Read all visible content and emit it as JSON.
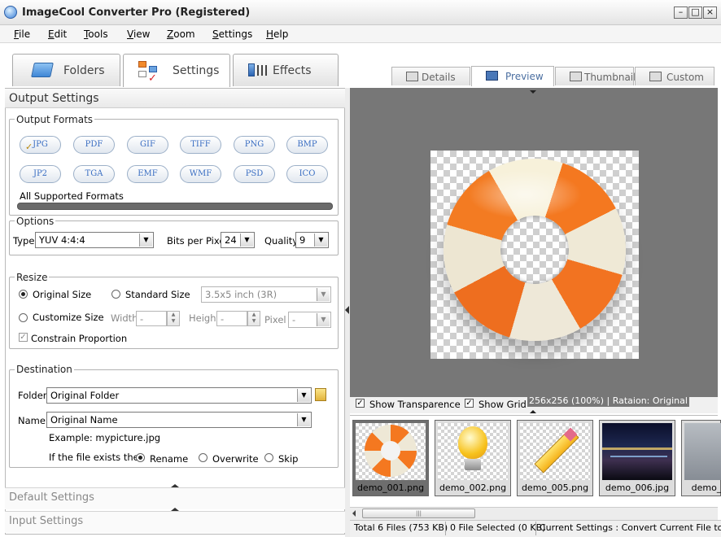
{
  "window": {
    "title": "ImageCool Converter Pro  (Registered)",
    "minimize": "–",
    "maximize": "□",
    "close": "×"
  },
  "menu": [
    "File",
    "Edit",
    "Tools",
    "View",
    "Zoom",
    "Settings",
    "Help"
  ],
  "main_tabs": [
    {
      "label": "Folders",
      "icon": "folder-icon",
      "active": false
    },
    {
      "label": "Settings",
      "icon": "settings-icon",
      "active": true
    },
    {
      "label": "Effects",
      "icon": "effects-icon",
      "active": false
    }
  ],
  "view_tabs": [
    {
      "label": "Details",
      "active": false
    },
    {
      "label": "Preview",
      "active": true
    },
    {
      "label": "Thumbnails",
      "active": false
    },
    {
      "label": "Custom",
      "active": false
    }
  ],
  "output_settings": {
    "title": "Output Settings",
    "formats_title": "Output Formats",
    "formats": [
      "JPG",
      "PDF",
      "GIF",
      "TIFF",
      "PNG",
      "BMP",
      "JP2",
      "TGA",
      "EMF",
      "WMF",
      "PSD",
      "ICO"
    ],
    "selected_format": "JPG",
    "all_supported": "All Supported Formats",
    "options": {
      "title": "Options",
      "type_label": "Type",
      "type_value": "YUV 4:4:4",
      "bpp_label": "Bits per Pixel",
      "bpp_value": "24",
      "quality_label": "Quality",
      "quality_value": "9"
    },
    "resize": {
      "title": "Resize",
      "original_size": "Original Size",
      "standard_size": "Standard Size",
      "standard_value": "3.5x5 inch (3R)",
      "customize_size": "Customize Size",
      "width_label": "Width",
      "width_value": "-",
      "height_label": "Height",
      "height_value": "-",
      "pixel_label": "Pixel",
      "pixel_value": "-",
      "constrain": "Constrain Proportion",
      "selected": "original"
    },
    "destination": {
      "title": "Destination",
      "folder_label": "Folder",
      "folder_value": "Original Folder",
      "name_label": "Name",
      "name_value": "Original Name",
      "example": "Example: mypicture.jpg",
      "exists_label": "If the file exists then",
      "rename": "Rename",
      "overwrite": "Overwrite",
      "skip": "Skip",
      "selected": "rename"
    }
  },
  "default_settings": "Default Settings",
  "input_settings": "Input Settings",
  "preview": {
    "show_transparence": "Show Transparence",
    "show_grid": "Show Grid",
    "info": "256x256 (100%)  |  Rataion: Original"
  },
  "thumbnails": [
    {
      "name": "demo_001.png",
      "icon": "lifebuoy-icon",
      "selected": true
    },
    {
      "name": "demo_002.png",
      "icon": "lightbulb-icon",
      "selected": false
    },
    {
      "name": "demo_005.png",
      "icon": "pencil-icon",
      "selected": false
    },
    {
      "name": "demo_006.jpg",
      "icon": "night-city-photo",
      "selected": false
    },
    {
      "name": "demo_",
      "icon": "foggy-photo",
      "selected": false
    }
  ],
  "status": {
    "total": "Total 6 Files (753 KB)",
    "selected": "0 File Selected (0 KB)",
    "current": "Current Settings : Convert Current File to JPG"
  },
  "colors": {
    "accent": "#3a6ec2",
    "preview_bg": "#777777",
    "ring_orange": "#f47820"
  }
}
